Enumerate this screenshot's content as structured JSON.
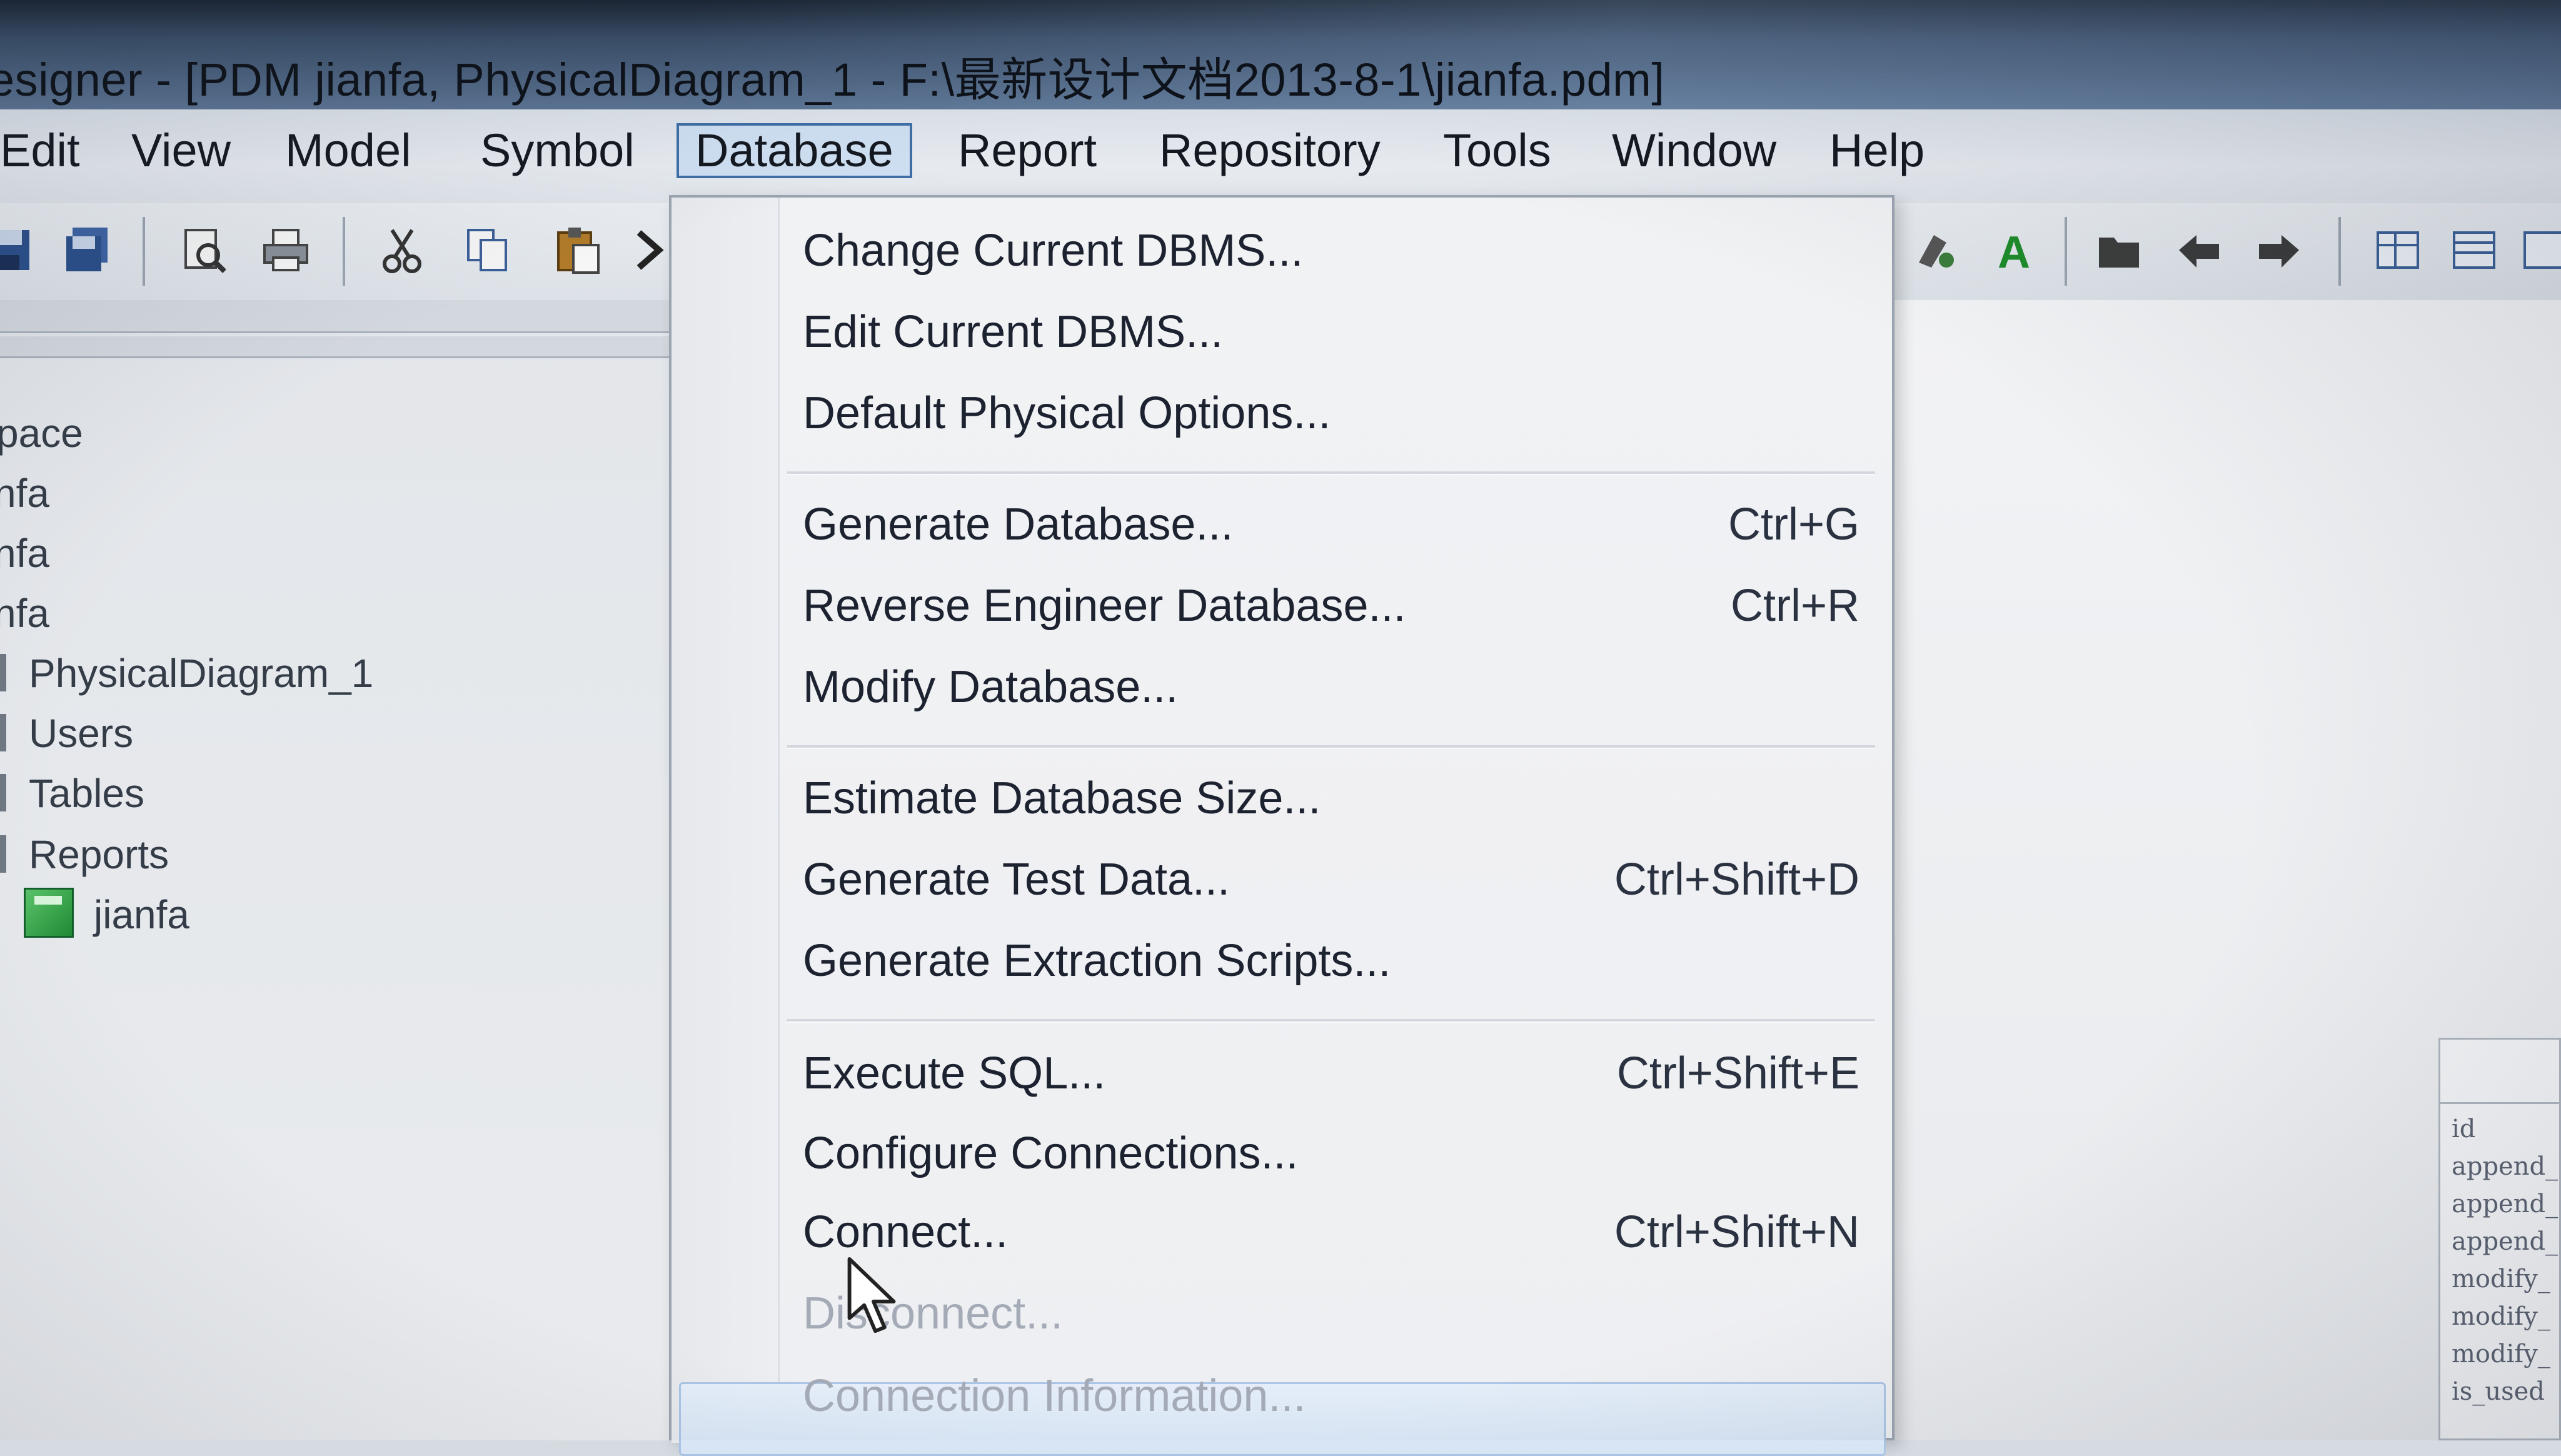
{
  "window": {
    "title": "esigner - [PDM jianfa, PhysicalDiagram_1 - F:\\最新设计文档2013-8-1\\jianfa.pdm]"
  },
  "menubar": {
    "items": [
      {
        "label": "Edit"
      },
      {
        "label": "View"
      },
      {
        "label": "Model"
      },
      {
        "label": "Symbol"
      },
      {
        "label": "Database",
        "active": true
      },
      {
        "label": "Report"
      },
      {
        "label": "Repository"
      },
      {
        "label": "Tools"
      },
      {
        "label": "Window"
      },
      {
        "label": "Help"
      }
    ]
  },
  "toolbar": {
    "left_icons": [
      "save-icon",
      "save-all-icon",
      "print-preview-icon",
      "print-icon",
      "cut-icon",
      "copy-icon",
      "paste-icon",
      "chevron-right-icon"
    ],
    "right_icons": [
      "format-painter-icon",
      "font-icon",
      "folder-icon",
      "undo-icon",
      "redo-icon",
      "grid-icon",
      "table-icon",
      "panel-icon"
    ]
  },
  "browser": {
    "items": [
      {
        "label": "pace"
      },
      {
        "label": "nfa"
      },
      {
        "label": "nfa"
      },
      {
        "label": "nfa"
      },
      {
        "label": "PhysicalDiagram_1"
      },
      {
        "label": "Users"
      },
      {
        "label": "Tables"
      },
      {
        "label": "Reports"
      },
      {
        "label": "jianfa"
      }
    ]
  },
  "database_menu": {
    "groups": [
      [
        {
          "label": "Change Current DBMS...",
          "shortcut": ""
        },
        {
          "label": "Edit Current DBMS...",
          "shortcut": ""
        },
        {
          "label": "Default Physical Options...",
          "shortcut": ""
        }
      ],
      [
        {
          "label": "Generate Database...",
          "shortcut": "Ctrl+G"
        },
        {
          "label": "Reverse Engineer Database...",
          "shortcut": "Ctrl+R"
        },
        {
          "label": "Modify Database...",
          "shortcut": ""
        }
      ],
      [
        {
          "label": "Estimate Database Size...",
          "shortcut": ""
        },
        {
          "label": "Generate Test Data...",
          "shortcut": "Ctrl+Shift+D"
        },
        {
          "label": "Generate Extraction Scripts...",
          "shortcut": ""
        }
      ],
      [
        {
          "label": "Execute SQL...",
          "shortcut": "Ctrl+Shift+E"
        },
        {
          "label": "Configure Connections...",
          "shortcut": ""
        },
        {
          "label": "Connect...",
          "shortcut": "Ctrl+Shift+N",
          "highlighted": true
        },
        {
          "label": "Disconnect...",
          "shortcut": "",
          "disabled": true
        },
        {
          "label": "Connection Information...",
          "shortcut": "",
          "disabled": true
        }
      ]
    ]
  },
  "diagram": {
    "entity_fields": [
      "id",
      "append_",
      "append_",
      "append_",
      "modify_",
      "modify_",
      "modify_",
      "is_used"
    ]
  },
  "colors": {
    "menu_active_border": "#3f6fa6",
    "menu_active_fill": "#cfe0f3",
    "hover_fill": "#d6e4f4",
    "disabled_text": "#a4abb6"
  }
}
